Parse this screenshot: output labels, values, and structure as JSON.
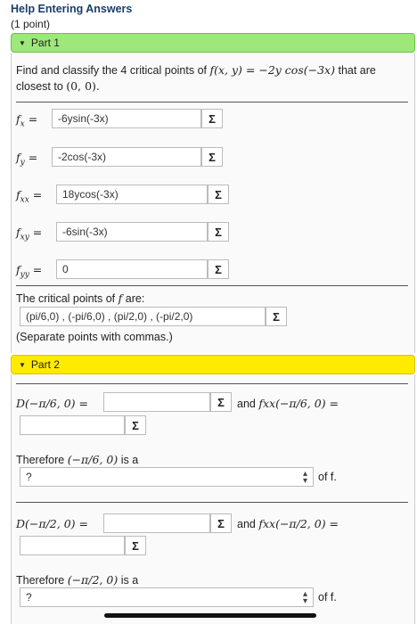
{
  "header": {
    "help_link": "Help Entering Answers",
    "points": "(1 point)"
  },
  "part1": {
    "header": "Part 1",
    "question_prefix": "Find and classify the 4 critical points of",
    "function": "f(x, y) = −2y cos(−3x)",
    "question_suffix": "that are closest to",
    "origin": "(0, 0).",
    "derivatives": [
      {
        "label": "fx =",
        "value": "-6ysin(-3x)"
      },
      {
        "label": "fy =",
        "value": "-2cos(-3x)"
      },
      {
        "label": "fxx =",
        "value": "18ycos(-3x)"
      },
      {
        "label": "fxy =",
        "value": "-6sin(-3x)"
      },
      {
        "label": "fyy =",
        "value": "0"
      }
    ],
    "critical_label_prefix": "The critical points of",
    "critical_label_f": "f",
    "critical_label_suffix": "are:",
    "critical_value": "(pi/6,0) , (-pi/6,0) , (pi/2,0) , (-pi/2,0)",
    "separate_note": "(Separate points with commas.)",
    "sigma": "Σ"
  },
  "part2": {
    "header": "Part 2",
    "blocks": [
      {
        "d_label": "D(−π/6, 0) =",
        "and_text": "and",
        "fxx_label": "fxx(−π/6, 0) =",
        "therefore": "Therefore",
        "point": "(−π/6, 0)",
        "is_a": "is a",
        "select_value": "?",
        "of_f": "of f."
      },
      {
        "d_label": "D(−π/2, 0) =",
        "and_text": "and",
        "fxx_label": "fxx(−π/2, 0) =",
        "therefore": "Therefore",
        "point": "(−π/2, 0)",
        "is_a": "is a",
        "select_value": "?",
        "of_f": "of f."
      }
    ]
  }
}
